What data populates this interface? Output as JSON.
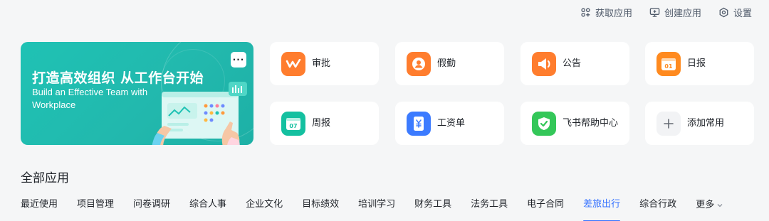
{
  "toolbar": {
    "get_apps": "获取应用",
    "create_app": "创建应用",
    "settings": "设置"
  },
  "banner": {
    "title": "打造高效组织 从工作台开始",
    "subtitle": "Build an Effective Team with Workplace",
    "more": "···",
    "background_color": "#20bcb0"
  },
  "apps": [
    {
      "label": "审批",
      "icon": "approval-icon",
      "color": "#ff7d2e"
    },
    {
      "label": "假勤",
      "icon": "attendance-icon",
      "color": "#ff7d2e"
    },
    {
      "label": "公告",
      "icon": "announcement-icon",
      "color": "#ff7d2e"
    },
    {
      "label": "日报",
      "icon": "daily-report-icon",
      "color": "#ff8a1f",
      "badge": "01"
    },
    {
      "label": "周报",
      "icon": "weekly-report-icon",
      "color": "#14c0a0",
      "badge": "07"
    },
    {
      "label": "工资单",
      "icon": "payslip-icon",
      "color": "#3c7bff"
    },
    {
      "label": "飞书帮助中心",
      "icon": "help-center-icon",
      "color": "#34c759"
    },
    {
      "label": "添加常用",
      "icon": "plus-icon",
      "color": "#f2f3f5"
    }
  ],
  "section_title": "全部应用",
  "categories": [
    "最近使用",
    "项目管理",
    "问卷调研",
    "综合人事",
    "企业文化",
    "目标绩效",
    "培训学习",
    "财务工具",
    "法务工具",
    "电子合同",
    "差旅出行",
    "综合行政"
  ],
  "active_category": "差旅出行",
  "more_label": "更多",
  "accent_color": "#3370ff"
}
